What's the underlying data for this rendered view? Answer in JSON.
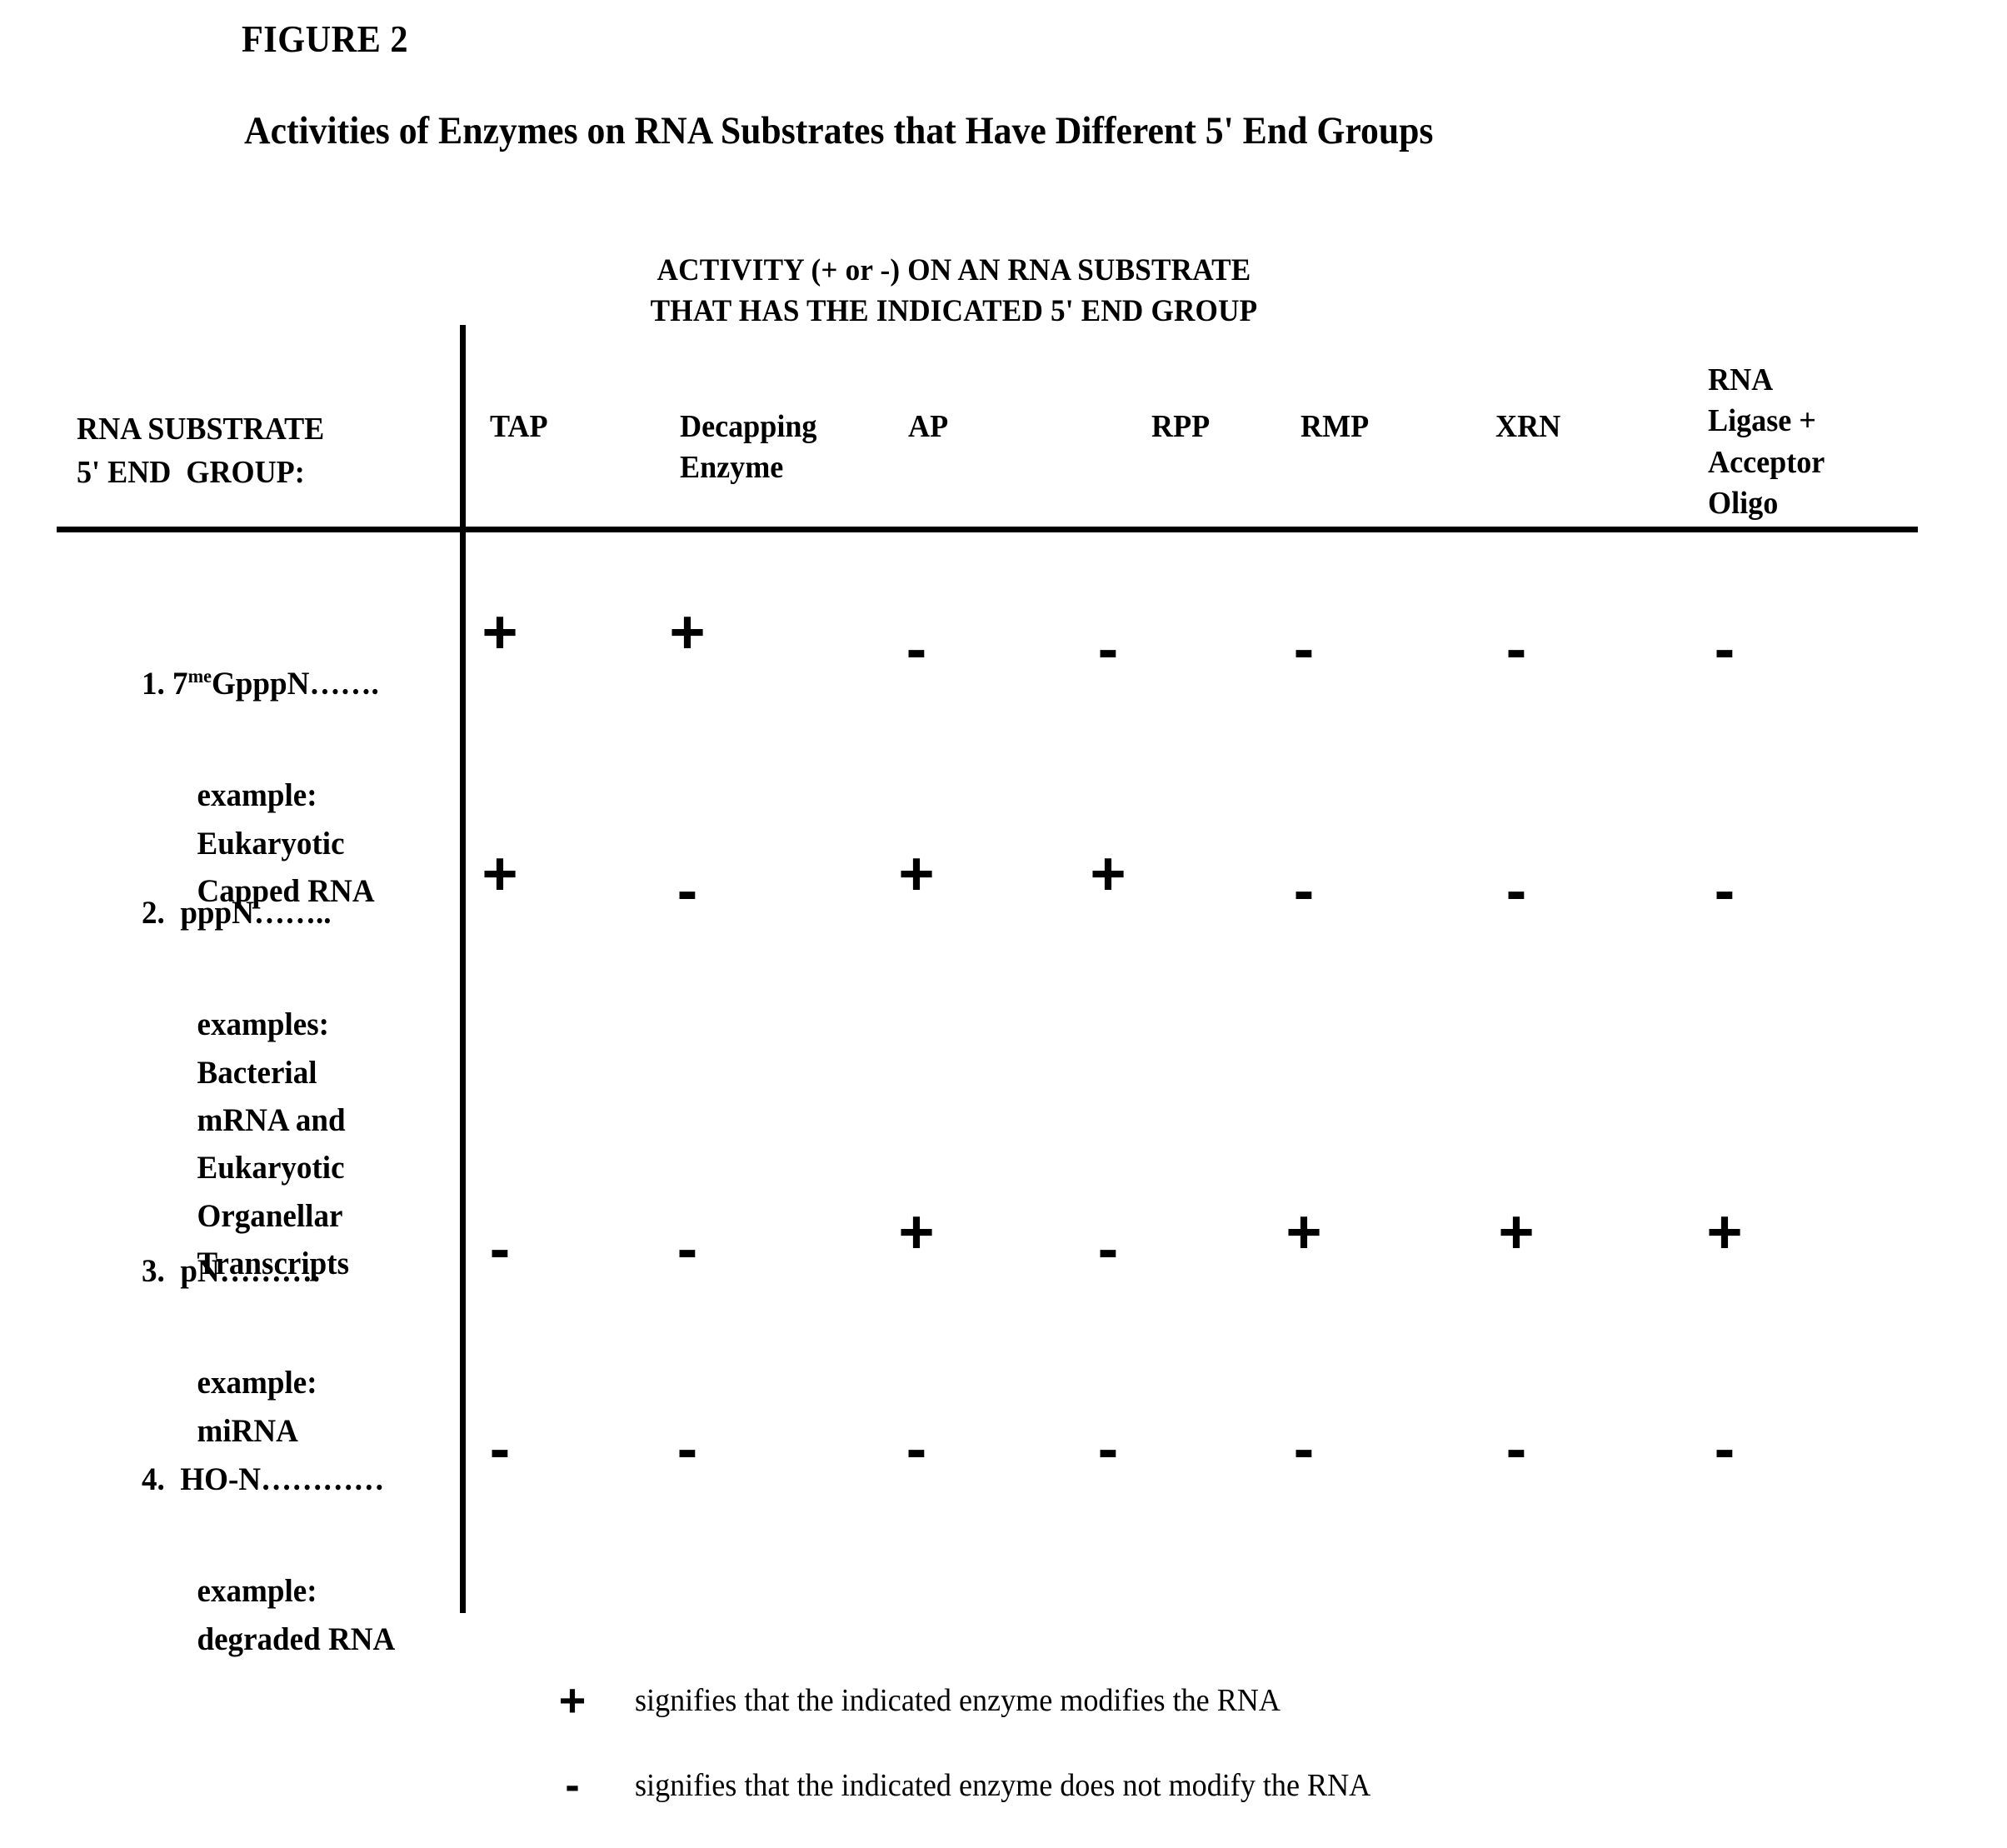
{
  "figure": {
    "label": "FIGURE 2",
    "title": "Activities of Enzymes on RNA Substrates that Have Different 5' End Groups"
  },
  "table": {
    "activity_header": "ACTIVITY (+ or -) ON AN RNA SUBSTRATE\nTHAT HAS THE INDICATED 5' END GROUP",
    "stub_header": "RNA SUBSTRATE\n5' END  GROUP:",
    "column_headers": [
      "TAP",
      "Decapping\nEnzyme",
      "AP",
      "RPP",
      "RMP",
      "XRN",
      "RNA\nLigase +\nAcceptor\nOligo"
    ],
    "rows": [
      {
        "number": "1.",
        "name_prefix": "7",
        "name_sup": "me",
        "name_suffix": "GpppN…….",
        "example": "example:\nEukaryotic\nCapped RNA",
        "values": [
          "+",
          "+",
          "-",
          "-",
          "-",
          "-",
          "-"
        ]
      },
      {
        "number": "2.",
        "name_prefix": " pppN……..",
        "name_sup": "",
        "name_suffix": "",
        "example": "examples:\nBacterial\nmRNA and\nEukaryotic\nOrganellar\nTranscripts",
        "values": [
          "+",
          "-",
          "+",
          "+",
          "-",
          "-",
          "-"
        ]
      },
      {
        "number": "3.",
        "name_prefix": " pN……….",
        "name_sup": "",
        "name_suffix": "",
        "example": "example:\nmiRNA",
        "values": [
          "-",
          "-",
          "+",
          "-",
          "+",
          "+",
          "+"
        ]
      },
      {
        "number": "4.",
        "name_prefix": " HO-N…………",
        "name_sup": "",
        "name_suffix": "",
        "example": "example:\ndegraded RNA",
        "values": [
          "-",
          "-",
          "-",
          "-",
          "-",
          "-",
          "-"
        ]
      }
    ]
  },
  "legend": [
    {
      "mark": "+",
      "text": "signifies that the indicated enzyme modifies the RNA"
    },
    {
      "mark": "-",
      "text": "signifies that the indicated enzyme does not modify the RNA"
    }
  ],
  "layout": {
    "column_x": [
      600,
      825,
      1100,
      1330,
      1565,
      1820,
      2070
    ],
    "row_mark_y": [
      740,
      1030,
      1460,
      1700
    ],
    "ink_color": "#000000"
  },
  "chart_data": {
    "type": "table",
    "title": "Activities of Enzymes on RNA Substrates that Have Different 5' End Groups",
    "columns": [
      "RNA SUBSTRATE 5' END  GROUP:",
      "TAP",
      "Decapping Enzyme",
      "AP",
      "RPP",
      "RMP",
      "XRN",
      "RNA Ligase + Acceptor Oligo"
    ],
    "rows": [
      [
        "1. 7meGpppN……. (example: Eukaryotic Capped RNA)",
        "+",
        "+",
        "-",
        "-",
        "-",
        "-",
        "-"
      ],
      [
        "2. pppN…….. (examples: Bacterial mRNA and Eukaryotic Organellar Transcripts)",
        "+",
        "-",
        "+",
        "+",
        "-",
        "-",
        "-"
      ],
      [
        "3. pN………. (example: miRNA)",
        "-",
        "-",
        "+",
        "-",
        "+",
        "+",
        "+"
      ],
      [
        "4. HO-N………… (example: degraded RNA)",
        "-",
        "-",
        "-",
        "-",
        "-",
        "-",
        "-"
      ]
    ],
    "legend": {
      "+": "signifies that the indicated enzyme modifies the RNA",
      "-": "signifies that the indicated enzyme does not modify the RNA"
    }
  }
}
